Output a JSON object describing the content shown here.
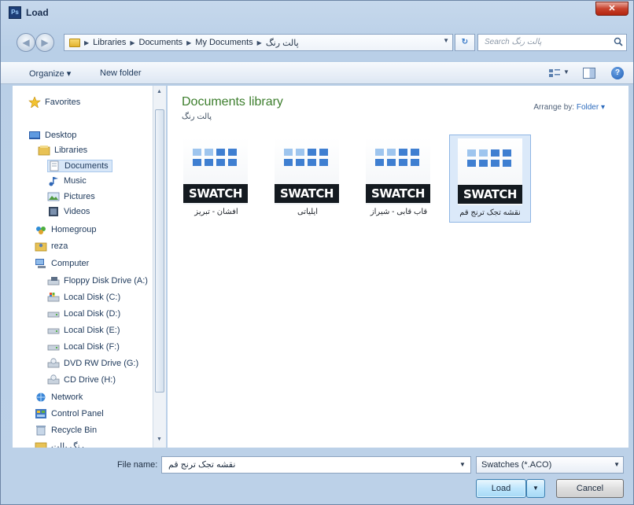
{
  "window": {
    "title": "Load",
    "app_icon_text": "Ps"
  },
  "address": {
    "crumbs": [
      "Libraries",
      "Documents",
      "My Documents",
      "پالت رنگ"
    ],
    "search_placeholder": "Search پالت رنگ"
  },
  "toolbar": {
    "organize_label": "Organize ▾",
    "new_folder_label": "New folder"
  },
  "nav": {
    "favorites": "Favorites",
    "desktop": "Desktop",
    "libraries": "Libraries",
    "documents": "Documents",
    "music": "Music",
    "pictures": "Pictures",
    "videos": "Videos",
    "homegroup": "Homegroup",
    "user": "reza",
    "computer": "Computer",
    "floppy": "Floppy Disk Drive (A:)",
    "disk_c": "Local Disk (C:)",
    "disk_d": "Local Disk (D:)",
    "disk_e": "Local Disk (E:)",
    "disk_f": "Local Disk (F:)",
    "dvd": "DVD RW Drive (G:)",
    "cd": "CD Drive (H:)",
    "network": "Network",
    "control_panel": "Control Panel",
    "recycle_bin": "Recycle Bin",
    "partial_folder": "رنگ پالت"
  },
  "content": {
    "library_title": "Documents library",
    "library_subtitle": "پالت رنگ",
    "arrange_label": "Arrange by:",
    "arrange_value": "Folder ▾",
    "files": [
      {
        "name": "افشان - تبریز",
        "label": "SWATCH"
      },
      {
        "name": "ایلیاتی",
        "label": "SWATCH"
      },
      {
        "name": "قاب قابی - شیراز",
        "label": "SWATCH"
      },
      {
        "name": "نقشه تجک ترنج قم",
        "label": "SWATCH"
      }
    ]
  },
  "bottom": {
    "file_name_label": "File name:",
    "file_name_value": "نقشه تجک ترنج قم",
    "filter_value": "Swatches (*.ACO)",
    "load_label": "Load",
    "cancel_label": "Cancel"
  },
  "colors": {
    "tile_dark": "#3f7fd1",
    "tile_light": "#9ec5ee",
    "swatch_bg": "#141a20",
    "library_title": "#3d7e2d"
  }
}
